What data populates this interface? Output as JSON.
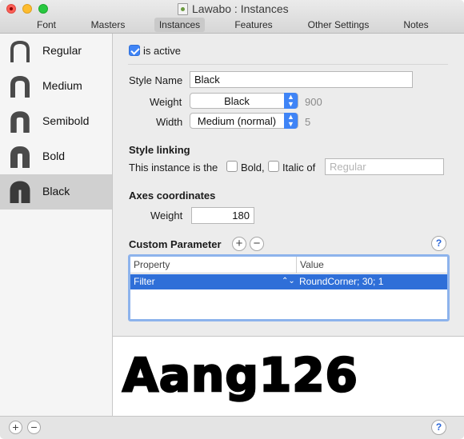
{
  "window": {
    "title": "Lawabo : Instances"
  },
  "tabs": [
    {
      "label": "Font"
    },
    {
      "label": "Masters"
    },
    {
      "label": "Instances"
    },
    {
      "label": "Features"
    },
    {
      "label": "Other Settings"
    },
    {
      "label": "Notes"
    }
  ],
  "active_tab": "Instances",
  "sidebar": {
    "items": [
      {
        "label": "Regular",
        "icon": "glyph-n-icon"
      },
      {
        "label": "Medium",
        "icon": "glyph-n-icon"
      },
      {
        "label": "Semibold",
        "icon": "glyph-n-icon"
      },
      {
        "label": "Bold",
        "icon": "glyph-n-icon"
      },
      {
        "label": "Black",
        "icon": "glyph-n-icon",
        "selected": true
      }
    ]
  },
  "instance": {
    "is_active_label": "is active",
    "is_active": true,
    "style_name_label": "Style Name",
    "style_name_value": "Black",
    "weight_label": "Weight",
    "weight_value": "Black",
    "weight_number": "900",
    "width_label": "Width",
    "width_value": "Medium (normal)",
    "width_number": "5"
  },
  "style_linking": {
    "heading": "Style linking",
    "prefix": "This instance is the",
    "bold_label": "Bold,",
    "italic_label": "Italic of",
    "placeholder": "Regular"
  },
  "axes": {
    "heading": "Axes coordinates",
    "weight_label": "Weight",
    "weight_value": "180"
  },
  "custom_parameter": {
    "heading": "Custom Parameter",
    "columns": [
      "Property",
      "Value"
    ],
    "rows": [
      {
        "property": "Filter",
        "value": "RoundCorner; 30; 1"
      }
    ]
  },
  "preview": {
    "text": "Aang126"
  },
  "bottom_bar": {
    "add": "+",
    "remove": "−",
    "help": "?"
  },
  "colors": {
    "accent": "#3f84f6",
    "selection": "#2f6fd8"
  }
}
